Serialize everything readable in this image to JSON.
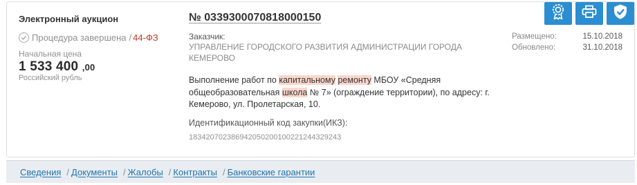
{
  "purchase": {
    "type": "Электронный аукцион",
    "status": "Процедура завершена",
    "law_separator": "/",
    "law": "44-ФЗ",
    "price_label": "Начальная цена",
    "price_int": "1 533 400",
    "price_cents": ",00",
    "currency": "Российский рубль",
    "number": "№ 0339300070818000150",
    "customer_label": "Заказчик:",
    "customer_name": "УПРАВЛЕНИЕ ГОРОДСКОГО РАЗВИТИЯ АДМИНИСТРАЦИИ ГОРОДА КЕМЕРОВО",
    "desc": {
      "p1": "Выполнение работ по ",
      "h1": "капитальному",
      "p2": " ",
      "h2": "ремонту",
      "p3": " МБОУ «Средняя общеобразовательная ",
      "h3": "школа",
      "p4": " № 7» (ограждение территории), по адресу: г. Кемерово, ул. Пролетарская, 10."
    },
    "ikz_label": "Идентификационный код закупки(ИКЗ):",
    "ikz_value": "183420702386942050200100221244329243",
    "posted_label": "Размещено:",
    "posted_date": "15.10.2018",
    "updated_label": "Обновлено:",
    "updated_date": "31.10.2018"
  },
  "actions": {
    "icons": [
      "award-icon",
      "print-icon",
      "shield-check-icon"
    ],
    "color": "#2b8ed0"
  },
  "tabs": [
    {
      "label": "Сведения"
    },
    {
      "label": "Документы"
    },
    {
      "label": "Жалобы"
    },
    {
      "label": "Контракты"
    },
    {
      "label": "Банковские гарантии"
    }
  ],
  "tab_separator": "/",
  "colors": {
    "accent": "#2b8ed0",
    "law": "#c0392b",
    "highlight": "#f9d7cc",
    "link": "#1e72b0"
  }
}
